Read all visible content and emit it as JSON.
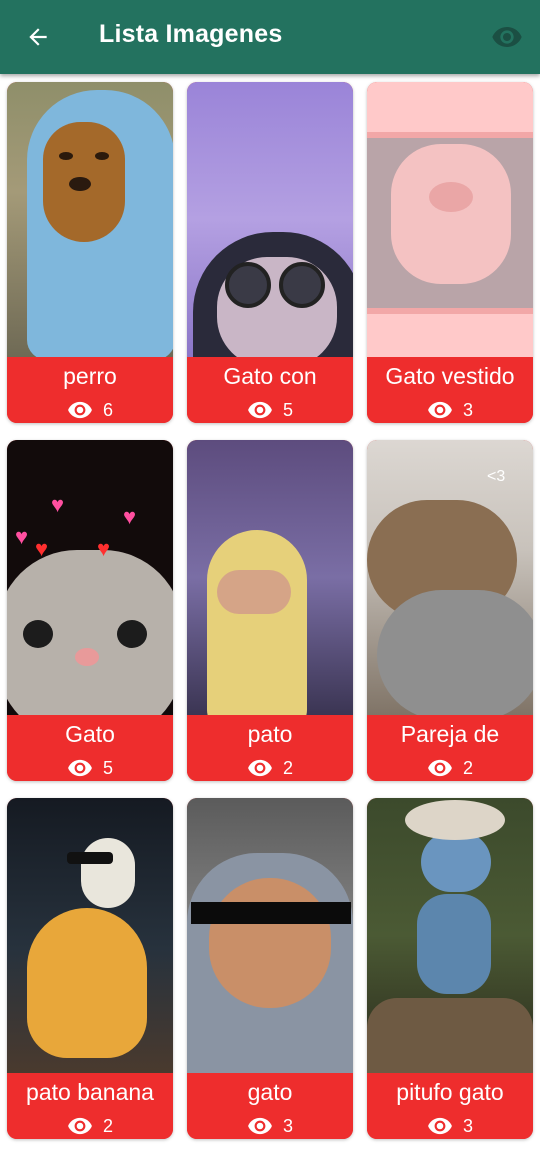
{
  "app_bar": {
    "title": "Lista Imagenes",
    "back_icon": "arrow-left-icon",
    "action_icon": "eye-icon",
    "background": "#23725f"
  },
  "theme": {
    "caption_background": "#ee2d2d",
    "caption_text": "#ffffff"
  },
  "images": [
    {
      "name": "perro",
      "views": "6"
    },
    {
      "name": "Gato con",
      "views": "5"
    },
    {
      "name": "Gato vestido",
      "views": "3"
    },
    {
      "name": "Gato",
      "views": "5"
    },
    {
      "name": "pato",
      "views": "2"
    },
    {
      "name": "Pareja de",
      "views": "2",
      "thumb_text": "<3"
    },
    {
      "name": "pato banana",
      "views": "2"
    },
    {
      "name": "gato",
      "views": "3"
    },
    {
      "name": "pitufo gato",
      "views": "3"
    }
  ]
}
